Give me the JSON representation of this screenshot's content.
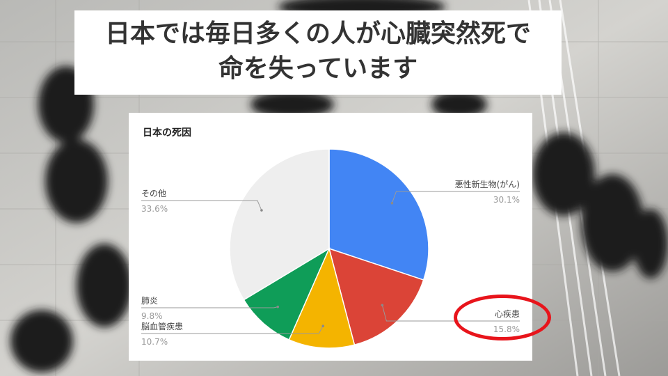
{
  "banner": {
    "line1": "日本では毎日多くの人が心臓突然死で",
    "line2": "命を失っています"
  },
  "chart_data": {
    "type": "pie",
    "title": "日本の死因",
    "slices": [
      {
        "name": "悪性新生物(がん)",
        "value": 30.1,
        "label": "30.1%",
        "color": "#4285f4"
      },
      {
        "name": "心疾患",
        "value": 15.8,
        "label": "15.8%",
        "color": "#db4437"
      },
      {
        "name": "脳血管疾患",
        "value": 10.7,
        "label": "10.7%",
        "color": "#f4b400"
      },
      {
        "name": "肺炎",
        "value": 9.8,
        "label": "9.8%",
        "color": "#0f9d58"
      },
      {
        "name": "その他",
        "value": 33.6,
        "label": "33.6%",
        "color": "#eeeeee"
      }
    ],
    "highlighted": "心疾患",
    "highlight_color": "#e8141b"
  }
}
